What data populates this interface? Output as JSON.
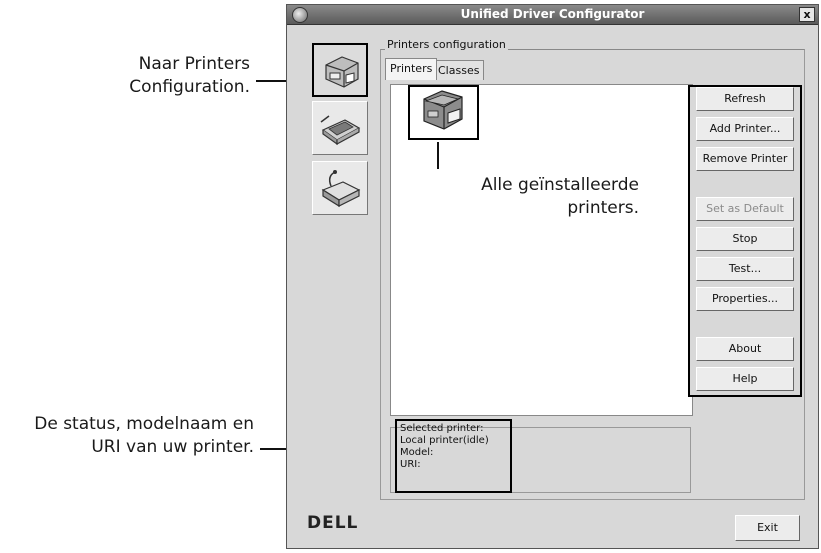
{
  "window": {
    "title": "Unified Driver Configurator",
    "close_glyph": "x"
  },
  "sidebar": {
    "items": [
      {
        "name": "printers-configuration",
        "icon": "printer-icon",
        "active": true
      },
      {
        "name": "scanners-configuration",
        "icon": "scanner-icon",
        "active": false
      },
      {
        "name": "ports-configuration",
        "icon": "port-icon",
        "active": false
      }
    ]
  },
  "group": {
    "label": "Printers configuration"
  },
  "tabs": [
    {
      "label": "Printers",
      "active": true
    },
    {
      "label": "Classes",
      "active": false
    }
  ],
  "buttons": {
    "refresh": "Refresh",
    "add_printer": "Add Printer...",
    "remove_printer": "Remove Printer",
    "set_default": "Set as Default",
    "stop": "Stop",
    "test": "Test...",
    "properties": "Properties...",
    "about": "About",
    "help": "Help",
    "exit": "Exit"
  },
  "selected_printer": {
    "header": "Selected printer:",
    "status": "Local printer(idle)",
    "model": "Model:",
    "uri": "URI:"
  },
  "brand": {
    "logo": "DELL"
  },
  "annotations": {
    "printers_config_line1": "Naar Printers",
    "printers_config_line2": "Configuration.",
    "installed_line1": "Alle geïnstalleerde",
    "installed_line2": "printers.",
    "status_line1": "De status, modelnaam en",
    "status_line2": "URI van uw printer."
  }
}
